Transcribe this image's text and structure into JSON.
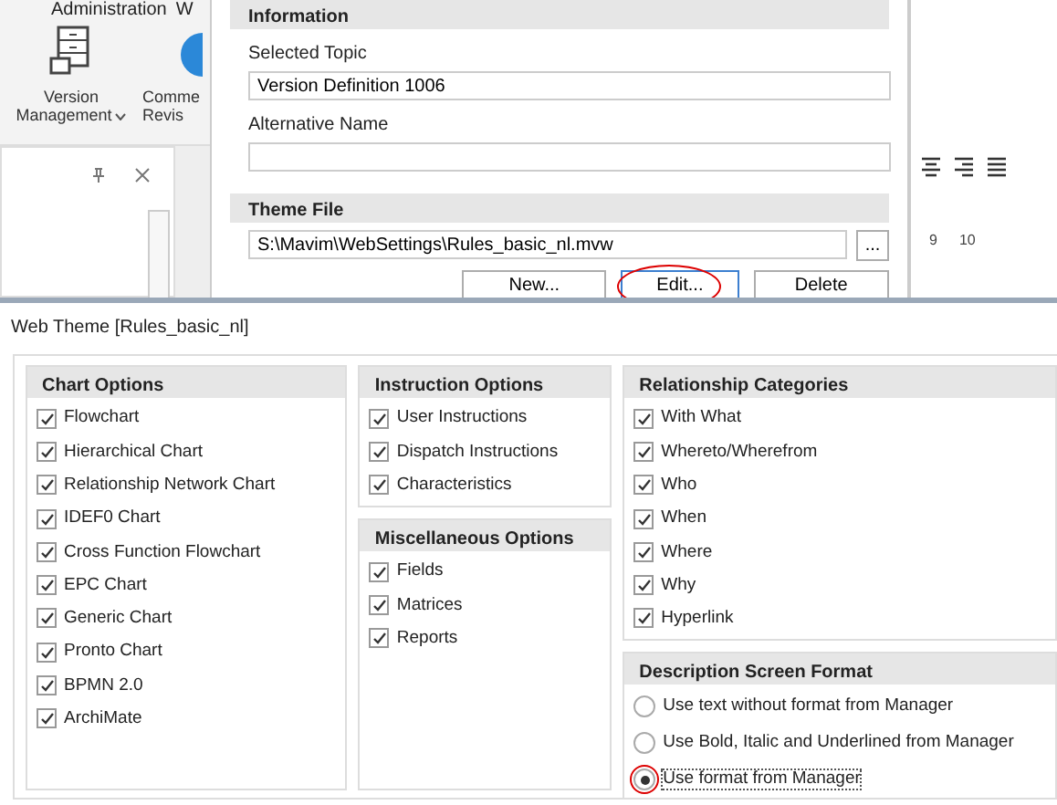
{
  "ribbon": {
    "tabs": [
      "Administration",
      "W"
    ],
    "buttons": [
      {
        "kind": "version",
        "label": "Version\nManagement",
        "dropdown": true
      },
      {
        "kind": "comment",
        "label": "Comme\nRevis"
      }
    ]
  },
  "topic_dialog": {
    "information": {
      "title": "Information",
      "selected_topic_label": "Selected Topic",
      "selected_topic_value": "Version Definition 1006",
      "alternative_name_label": "Alternative Name"
    },
    "theme_file": {
      "title": "Theme File",
      "path": "S:\\Mavim\\WebSettings\\Rules_basic_nl.mvw",
      "browse": "...",
      "buttons": [
        {
          "label": "New...",
          "highlighted": false,
          "focused": false
        },
        {
          "label": "Edit...",
          "highlighted": true,
          "focused": true
        },
        {
          "label": "Delete",
          "highlighted": false,
          "focused": false
        }
      ]
    }
  },
  "editor": {
    "ruler": [
      "9",
      "10"
    ]
  },
  "web_theme": {
    "title": "Web Theme [Rules_basic_nl]",
    "columns": [
      [
        {
          "title": "Chart Options",
          "items": [
            {
              "kind": "checkbox",
              "label": "Flowchart",
              "checked": true
            },
            {
              "kind": "checkbox",
              "label": "Hierarchical Chart",
              "checked": true
            },
            {
              "kind": "checkbox",
              "label": "Relationship Network Chart",
              "checked": true
            },
            {
              "kind": "checkbox",
              "label": "IDEF0 Chart",
              "checked": true
            },
            {
              "kind": "checkbox",
              "label": "Cross Function Flowchart",
              "checked": true
            },
            {
              "kind": "checkbox",
              "label": "EPC Chart",
              "checked": true
            },
            {
              "kind": "checkbox",
              "label": "Generic Chart",
              "checked": true
            },
            {
              "kind": "checkbox",
              "label": "Pronto Chart",
              "checked": true
            },
            {
              "kind": "checkbox",
              "label": "BPMN 2.0",
              "checked": true
            },
            {
              "kind": "checkbox",
              "label": "ArchiMate",
              "checked": true
            }
          ]
        }
      ],
      [
        {
          "title": "Instruction Options",
          "items": [
            {
              "kind": "checkbox",
              "label": "User Instructions",
              "checked": true
            },
            {
              "kind": "checkbox",
              "label": "Dispatch Instructions",
              "checked": true
            },
            {
              "kind": "checkbox",
              "label": "Characteristics",
              "checked": true
            }
          ]
        },
        {
          "title": "Miscellaneous Options",
          "items": [
            {
              "kind": "checkbox",
              "label": "Fields",
              "checked": true
            },
            {
              "kind": "checkbox",
              "label": "Matrices",
              "checked": true
            },
            {
              "kind": "checkbox",
              "label": "Reports",
              "checked": true
            }
          ]
        }
      ],
      [
        {
          "title": "Relationship Categories",
          "items": [
            {
              "kind": "checkbox",
              "label": "With What",
              "checked": true
            },
            {
              "kind": "checkbox",
              "label": "Whereto/Wherefrom",
              "checked": true
            },
            {
              "kind": "checkbox",
              "label": "Who",
              "checked": true
            },
            {
              "kind": "checkbox",
              "label": "When",
              "checked": true
            },
            {
              "kind": "checkbox",
              "label": "Where",
              "checked": true
            },
            {
              "kind": "checkbox",
              "label": "Why",
              "checked": true
            },
            {
              "kind": "checkbox",
              "label": "Hyperlink",
              "checked": true
            }
          ]
        },
        {
          "title": "Description Screen Format",
          "items": [
            {
              "kind": "radio",
              "label": "Use text without format from Manager",
              "selected": false,
              "highlighted": false
            },
            {
              "kind": "radio",
              "label": "Use Bold, Italic and Underlined from Manager",
              "selected": false,
              "highlighted": false
            },
            {
              "kind": "radio",
              "label": "Use format from Manager",
              "selected": true,
              "highlighted": true
            }
          ]
        }
      ]
    ]
  }
}
